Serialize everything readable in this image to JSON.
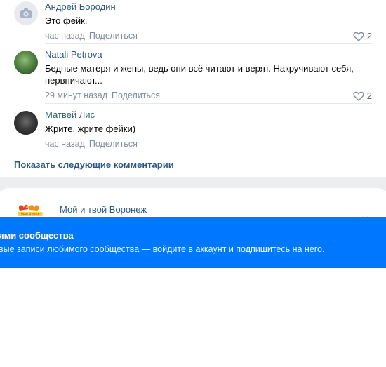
{
  "comments": [
    {
      "author": "Андрей Бородин",
      "text": "Это фейк.",
      "time": "час назад",
      "share": "Поделиться",
      "likes": "2",
      "avatar": "camera-placeholder-icon"
    },
    {
      "author": "Natali Petrova",
      "text": "Бедные матеря и жены, ведь они всё читают и верят. Накручивают себя, нервничают...",
      "time": "29 минут назад",
      "share": "Поделиться",
      "likes": "2",
      "avatar": "photo"
    },
    {
      "author": "Матвей Лис",
      "text": "Жрите, жрите фейки)",
      "time": "час назад",
      "share": "Поделиться",
      "likes": "",
      "avatar": "photo"
    }
  ],
  "show_more_label": "Показать следующие комментарии",
  "next_post": {
    "community_name": "Мой и твой Воронеж",
    "logo_text": "Мой и твой"
  },
  "banner": {
    "title": "ями сообщества",
    "text": "вые записи любимого сообщества — войдите в аккаунт и подпишитесь на него."
  },
  "colors": {
    "link": "#2a5885",
    "banner": "#0077ff",
    "meta": "#818c99"
  }
}
